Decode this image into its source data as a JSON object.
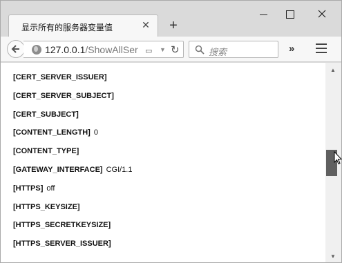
{
  "tab": {
    "title": "显示所有的服务器变量值",
    "close_glyph": "✕",
    "new_tab_glyph": "+"
  },
  "nav": {
    "url_host": "127.0.0.1",
    "url_path": "/ShowAllSer",
    "search_placeholder": "搜索",
    "overflow_glyph": "»",
    "reader_glyph": "▭",
    "dropdown_glyph": "▼",
    "reload_glyph": "↻"
  },
  "variables": [
    {
      "key": "[CERT_SERVER_ISSUER]",
      "value": ""
    },
    {
      "key": "[CERT_SERVER_SUBJECT]",
      "value": ""
    },
    {
      "key": "[CERT_SUBJECT]",
      "value": ""
    },
    {
      "key": "[CONTENT_LENGTH]",
      "value": "0"
    },
    {
      "key": "[CONTENT_TYPE]",
      "value": ""
    },
    {
      "key": "[GATEWAY_INTERFACE]",
      "value": "CGI/1.1"
    },
    {
      "key": "[HTTPS]",
      "value": "off"
    },
    {
      "key": "[HTTPS_KEYSIZE]",
      "value": ""
    },
    {
      "key": "[HTTPS_SECRETKEYSIZE]",
      "value": ""
    },
    {
      "key": "[HTTPS_SERVER_ISSUER]",
      "value": ""
    }
  ],
  "scroll": {
    "up_glyph": "▲",
    "down_glyph": "▼",
    "position_fraction": 0.5
  },
  "colors": {
    "content_bg": "#ffffff",
    "chrome_bg": "#dadada",
    "thumb": "#606060"
  }
}
